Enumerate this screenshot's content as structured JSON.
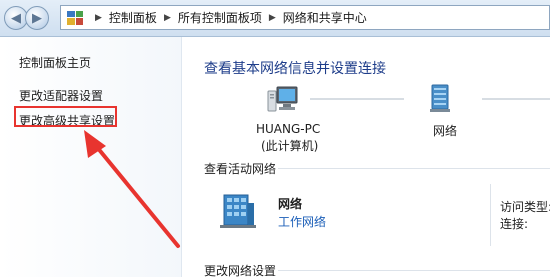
{
  "address_bar": {
    "breadcrumbs": [
      "控制面板",
      "所有控制面板项",
      "网络和共享中心"
    ]
  },
  "sidebar": {
    "items": [
      {
        "label": "控制面板主页"
      },
      {
        "label": "更改适配器设置"
      },
      {
        "label": "更改高级共享设置"
      }
    ]
  },
  "main": {
    "title": "查看基本网络信息并设置连接",
    "computer": {
      "name": "HUANG-PC",
      "sub": "(此计算机)"
    },
    "network_label": "网络",
    "active_section": "查看活动网络",
    "active_network": {
      "name": "网络",
      "type": "工作网络"
    },
    "access_type_label": "访问类型:",
    "connection_label": "连接:",
    "change_section": "更改网络设置"
  },
  "colors": {
    "annotation": "#e8342f",
    "link": "#1c5fb8",
    "title": "#1e3d8a"
  }
}
